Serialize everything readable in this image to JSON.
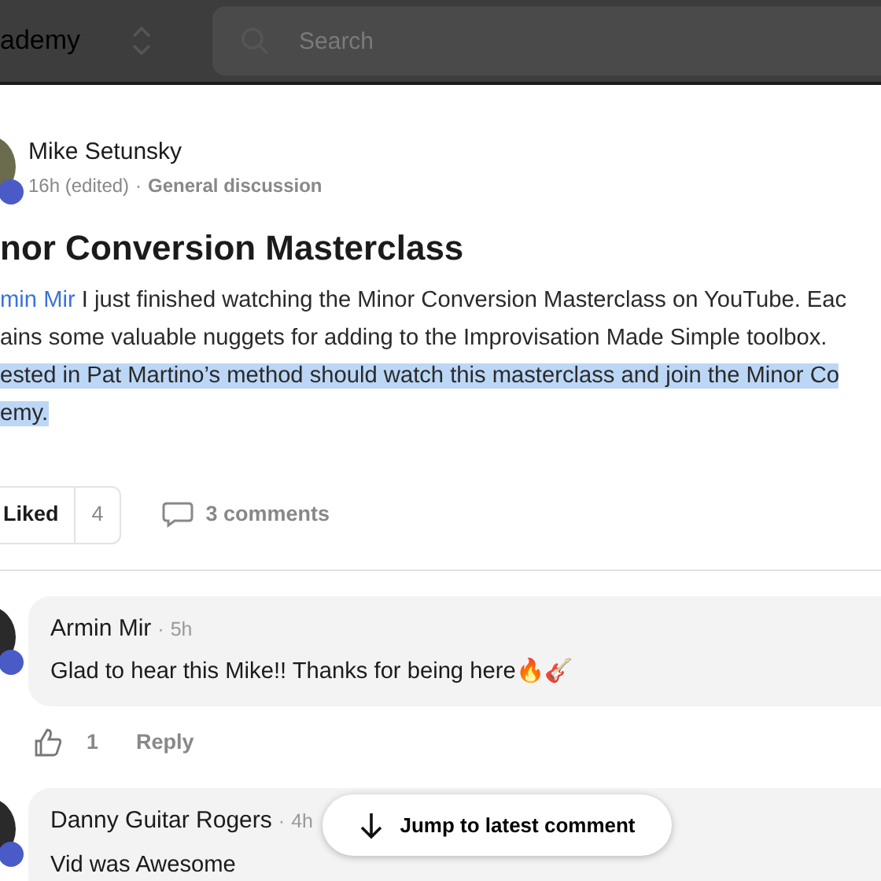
{
  "header": {
    "community": "ademy",
    "search": {
      "placeholder": "Search"
    }
  },
  "post": {
    "author": "Mike Setunsky",
    "time": "16h (edited)",
    "separator": "·",
    "category": "General discussion",
    "title": "nor Conversion Masterclass",
    "body_lines": [
      {
        "mention": "min Mir",
        "text": "I just finished watching the Minor Conversion Masterclass on YouTube. Eac",
        "highlighted": false
      },
      {
        "text": "ains some valuable nuggets for adding to the Improvisation Made Simple toolbox.",
        "highlighted": false
      },
      {
        "text": "ested in Pat Martino’s method should watch this masterclass and join the Minor Co",
        "highlighted": true
      },
      {
        "text": "emy.",
        "highlighted": true
      }
    ],
    "like": {
      "label": "Liked",
      "count": "4",
      "liked": true
    },
    "comments_label": "3 comments"
  },
  "comments": [
    {
      "author": "Armin Mir",
      "separator": "·",
      "time": "5h",
      "text": "Glad to hear this Mike!! Thanks for being here🔥🎸",
      "actions": {
        "likes": "1",
        "reply": "Reply"
      }
    },
    {
      "author": "Danny Guitar Rogers",
      "separator": "·",
      "time": "4h",
      "text": "Vid was Awesome"
    }
  ],
  "jump_button": "Jump to latest comment"
}
